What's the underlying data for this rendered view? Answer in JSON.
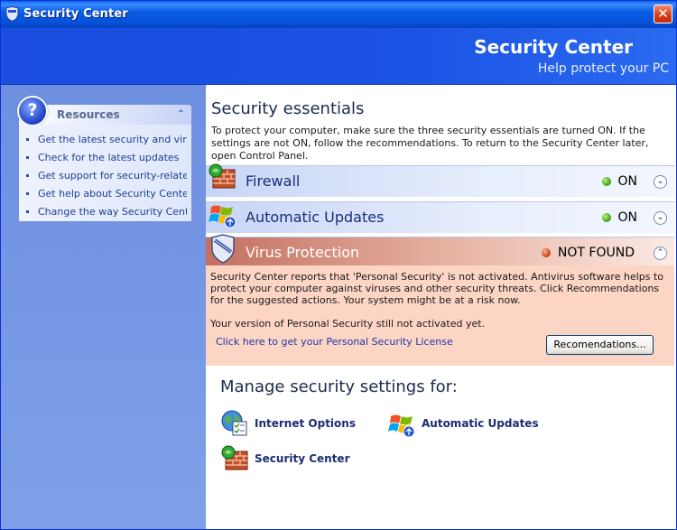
{
  "window": {
    "title": "Security Center",
    "close_glyph": "✕",
    "icon": "shield-icon"
  },
  "banner": {
    "title": "Security Center",
    "subtitle": "Help protect your PC"
  },
  "resources": {
    "header": "Resources",
    "icon": "help-icon",
    "collapse_glyph": "⌃",
    "items": [
      "Get the latest security and virus...",
      "Check for the latest updates",
      "Get support for security-related...",
      "Get help about Security Center",
      "Change the way Security Cente..."
    ]
  },
  "main": {
    "heading": "Security essentials",
    "intro": "To protect your computer, make sure the three security essentials are turned ON. If the settings are not ON, follow the  recommendations. To return to the Security Center later, open Control Panel."
  },
  "essentials": [
    {
      "name": "Firewall",
      "status": "ON",
      "state": "ok",
      "icon": "firewall-icon",
      "chevron": "⌄"
    },
    {
      "name": "Automatic Updates",
      "status": "ON",
      "state": "ok",
      "icon": "windows-update-icon",
      "chevron": "⌄"
    },
    {
      "name": "Virus Protection",
      "status": "NOT FOUND",
      "state": "bad",
      "icon": "virus-shield-icon",
      "chevron": "⌃"
    }
  ],
  "virus_detail": {
    "text": "Security Center reports that 'Personal Security' is not activated. Antivirus software helps to protect your computer against viruses and other security threats. Click Recommendations for the suggested actions. Your system might be at a risk now.",
    "note": "Your version of Personal Security still not activated yet.",
    "link": "Click here to get your Personal Security License",
    "button": "Recomendations..."
  },
  "manage": {
    "heading": "Manage security settings for:",
    "items": [
      {
        "label": "Internet Options",
        "icon": "internet-options-icon"
      },
      {
        "label": "Automatic Updates",
        "icon": "windows-update-icon"
      },
      {
        "label": "Security Center",
        "icon": "firewall-icon"
      }
    ]
  },
  "colors": {
    "titlebar": "#0b5ee6",
    "banner": "#1b53e4",
    "left_pane": "#7a96df",
    "alert_bg": "#fcd5c4",
    "alert_header": "#c27060",
    "status_ok": "#3f9a16",
    "status_bad": "#c23a10"
  }
}
